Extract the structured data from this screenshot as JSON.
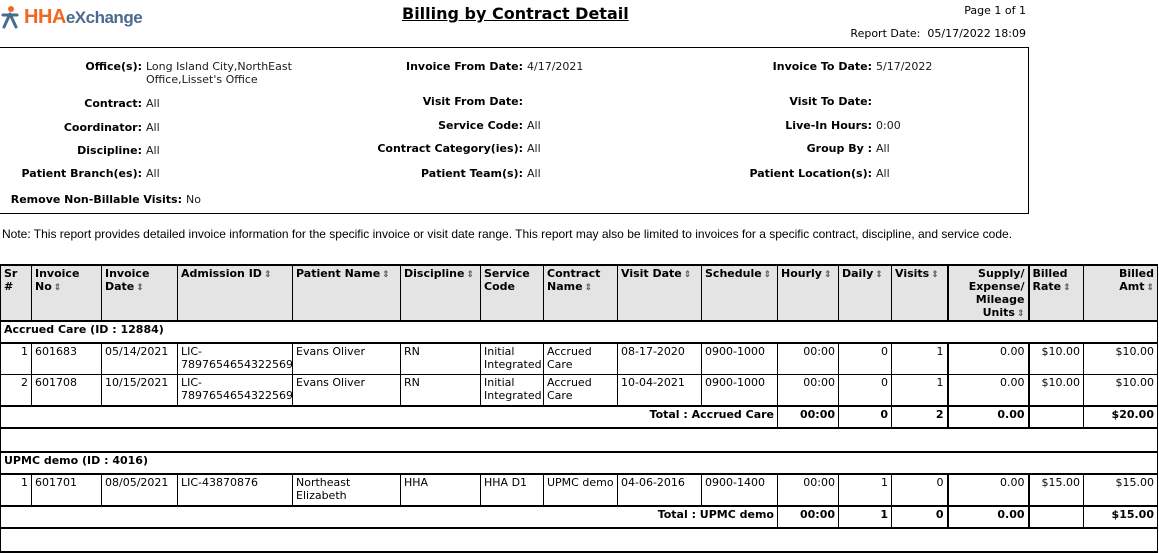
{
  "header": {
    "logo_hha": "HHA",
    "logo_exchange": "eXchange",
    "title": "Billing by Contract Detail",
    "page_label": "Page  1 of 1",
    "report_date_label": "Report Date:",
    "report_date": "05/17/2022 18:09"
  },
  "criteria": {
    "offices": {
      "label": "Office(s):",
      "value": "Long Island City,NorthEast Office,Lisset's Office"
    },
    "invoice_from": {
      "label": "Invoice From Date:",
      "value": "4/17/2021"
    },
    "invoice_to": {
      "label": "Invoice To Date:",
      "value": "5/17/2022"
    },
    "contract": {
      "label": "Contract:",
      "value": "All"
    },
    "visit_from": {
      "label": "Visit From Date:",
      "value": ""
    },
    "visit_to": {
      "label": "Visit To Date:",
      "value": ""
    },
    "coordinator": {
      "label": "Coordinator:",
      "value": "All"
    },
    "service_code": {
      "label": "Service Code:",
      "value": "All"
    },
    "live_in_hours": {
      "label": "Live-In Hours:",
      "value": "0:00"
    },
    "discipline": {
      "label": "Discipline:",
      "value": "All"
    },
    "contract_category": {
      "label": "Contract Category(ies):",
      "value": "All"
    },
    "group_by": {
      "label": "Group By :",
      "value": "All"
    },
    "patient_branch": {
      "label": "Patient Branch(es):",
      "value": "All"
    },
    "patient_team": {
      "label": "Patient Team(s):",
      "value": "All"
    },
    "patient_location": {
      "label": "Patient Location(s):",
      "value": "All"
    },
    "remove_non_billable": {
      "label": "Remove Non-Billable Visits:",
      "value": "No"
    }
  },
  "note": "Note: This report provides detailed invoice information for the specific invoice or visit date range. This report may also be limited to invoices for a specific contract, discipline, and service code.",
  "table": {
    "columns": [
      "Sr #",
      "Invoice No",
      "Invoice Date",
      "Admission ID",
      "Patient Name",
      "Discipline",
      "Service Code",
      "Contract Name",
      "Visit Date",
      "Schedule",
      "Hourly",
      "Daily",
      "Visits",
      "Supply/ Expense/ Mileage Units",
      "Billed Rate",
      "Billed Amt"
    ],
    "sort_icon": "sort-icon",
    "groups": [
      {
        "title": "Accrued Care (ID : 12884)",
        "rows": [
          {
            "sr": "1",
            "invoice_no": "601683",
            "invoice_date": "05/14/2021",
            "admission_id": "LIC-7897654654322569",
            "patient": "Evans Oliver",
            "discipline": "RN",
            "service_code": "Initial Integrated",
            "contract": "Accrued Care",
            "visit_date": "08-17-2020",
            "schedule": "0900-1000",
            "hourly": "00:00",
            "daily": "0",
            "visits": "1",
            "units": "0.00",
            "rate": "$10.00",
            "amt": "$10.00"
          },
          {
            "sr": "2",
            "invoice_no": "601708",
            "invoice_date": "10/15/2021",
            "admission_id": "LIC-7897654654322569",
            "patient": "Evans Oliver",
            "discipline": "RN",
            "service_code": "Initial Integrated",
            "contract": "Accrued Care",
            "visit_date": "10-04-2021",
            "schedule": "0900-1000",
            "hourly": "00:00",
            "daily": "0",
            "visits": "1",
            "units": "0.00",
            "rate": "$10.00",
            "amt": "$10.00"
          }
        ],
        "total": {
          "label": "Total : Accrued Care",
          "hourly": "00:00",
          "daily": "0",
          "visits": "2",
          "units": "0.00",
          "rate": "",
          "amt": "$20.00"
        }
      },
      {
        "title": "UPMC demo (ID : 4016)",
        "rows": [
          {
            "sr": "1",
            "invoice_no": "601701",
            "invoice_date": "08/05/2021",
            "admission_id": "LIC-43870876",
            "patient": "Northeast Elizabeth",
            "discipline": "HHA",
            "service_code": "HHA D1",
            "contract": "UPMC demo",
            "visit_date": "04-06-2016",
            "schedule": "0900-1400",
            "hourly": "00:00",
            "daily": "1",
            "visits": "0",
            "units": "0.00",
            "rate": "$15.00",
            "amt": "$15.00"
          }
        ],
        "total": {
          "label": "Total : UPMC demo",
          "hourly": "00:00",
          "daily": "1",
          "visits": "0",
          "units": "0.00",
          "rate": "",
          "amt": "$15.00"
        }
      }
    ]
  }
}
